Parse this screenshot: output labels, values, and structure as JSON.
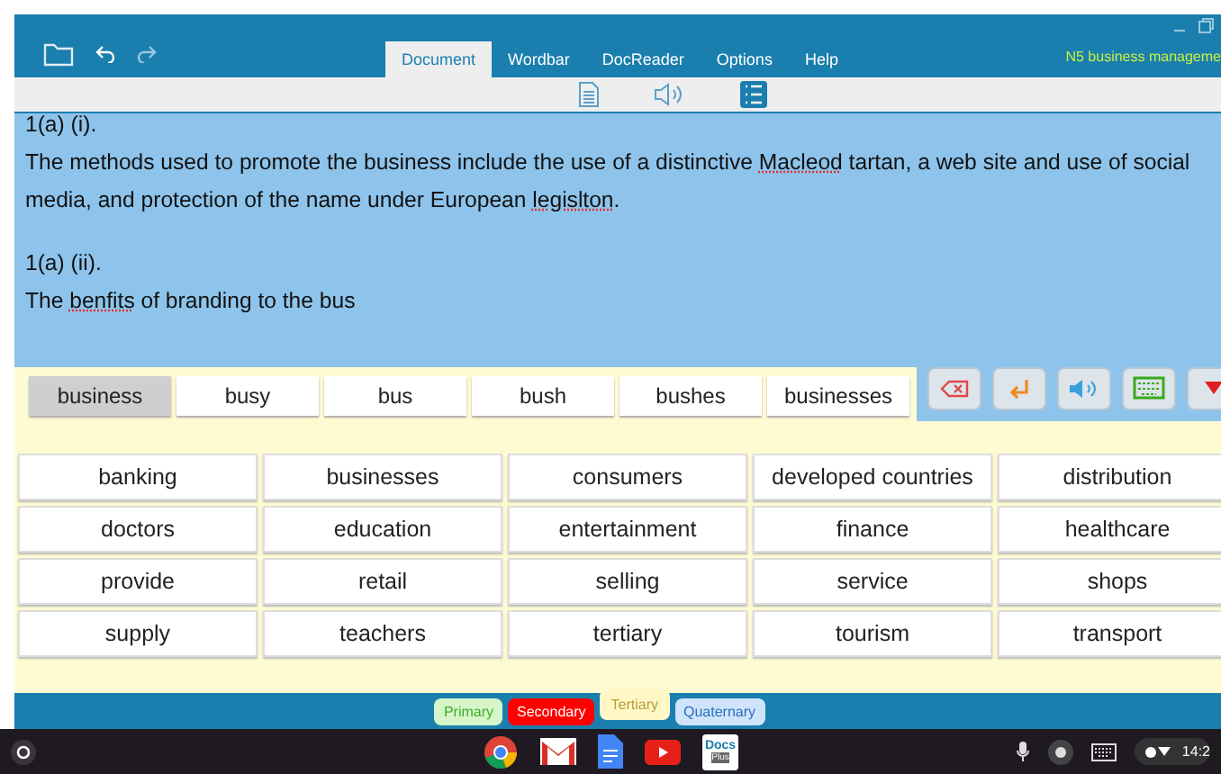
{
  "window": {
    "title": "N5 business manageme"
  },
  "menu_tabs": [
    {
      "label": "Document",
      "selected": true
    },
    {
      "label": "Wordbar",
      "selected": false
    },
    {
      "label": "DocReader",
      "selected": false
    },
    {
      "label": "Options",
      "selected": false
    },
    {
      "label": "Help",
      "selected": false
    }
  ],
  "document": {
    "paragraphs": [
      {
        "segments": [
          {
            "text": "1(a) (i).",
            "misspelled": false
          }
        ]
      },
      {
        "segments": [
          {
            "text": "The methods used to promote the business include the use of a distinctive ",
            "misspelled": false
          },
          {
            "text": "Macleod",
            "misspelled": true
          },
          {
            "text": " tartan, a web site and use of social media, and protection of the name under European ",
            "misspelled": false
          },
          {
            "text": "legislton",
            "misspelled": true
          },
          {
            "text": ".",
            "misspelled": false
          }
        ]
      },
      {
        "segments": [
          {
            "text": "1(a) (ii).",
            "misspelled": false
          }
        ]
      },
      {
        "segments": [
          {
            "text": "The ",
            "misspelled": false
          },
          {
            "text": "benfits",
            "misspelled": true
          },
          {
            "text": " of branding to the bus",
            "misspelled": false
          }
        ]
      }
    ]
  },
  "predictions": [
    {
      "word": "business",
      "selected": true
    },
    {
      "word": "busy",
      "selected": false
    },
    {
      "word": "bus",
      "selected": false
    },
    {
      "word": "bush",
      "selected": false
    },
    {
      "word": "bushes",
      "selected": false
    },
    {
      "word": "businesses",
      "selected": false
    }
  ],
  "word_grid": [
    "banking",
    "businesses",
    "consumers",
    "developed countries",
    "distribution",
    "doctors",
    "education",
    "entertainment",
    "finance",
    "healthcare",
    "provide",
    "retail",
    "selling",
    "service",
    "shops",
    "supply",
    "teachers",
    "tertiary",
    "tourism",
    "transport"
  ],
  "categories": [
    {
      "label": "Primary",
      "selected": false,
      "color": "#d6f5c8"
    },
    {
      "label": "Secondary",
      "selected": false,
      "color": "#ff0000"
    },
    {
      "label": "Tertiary",
      "selected": true,
      "color": "#fff8c6"
    },
    {
      "label": "Quaternary",
      "selected": false,
      "color": "#cfe4fb"
    }
  ],
  "taskbar": {
    "docs_plus": [
      "Docs",
      "Plus"
    ],
    "clock": "14:2"
  }
}
